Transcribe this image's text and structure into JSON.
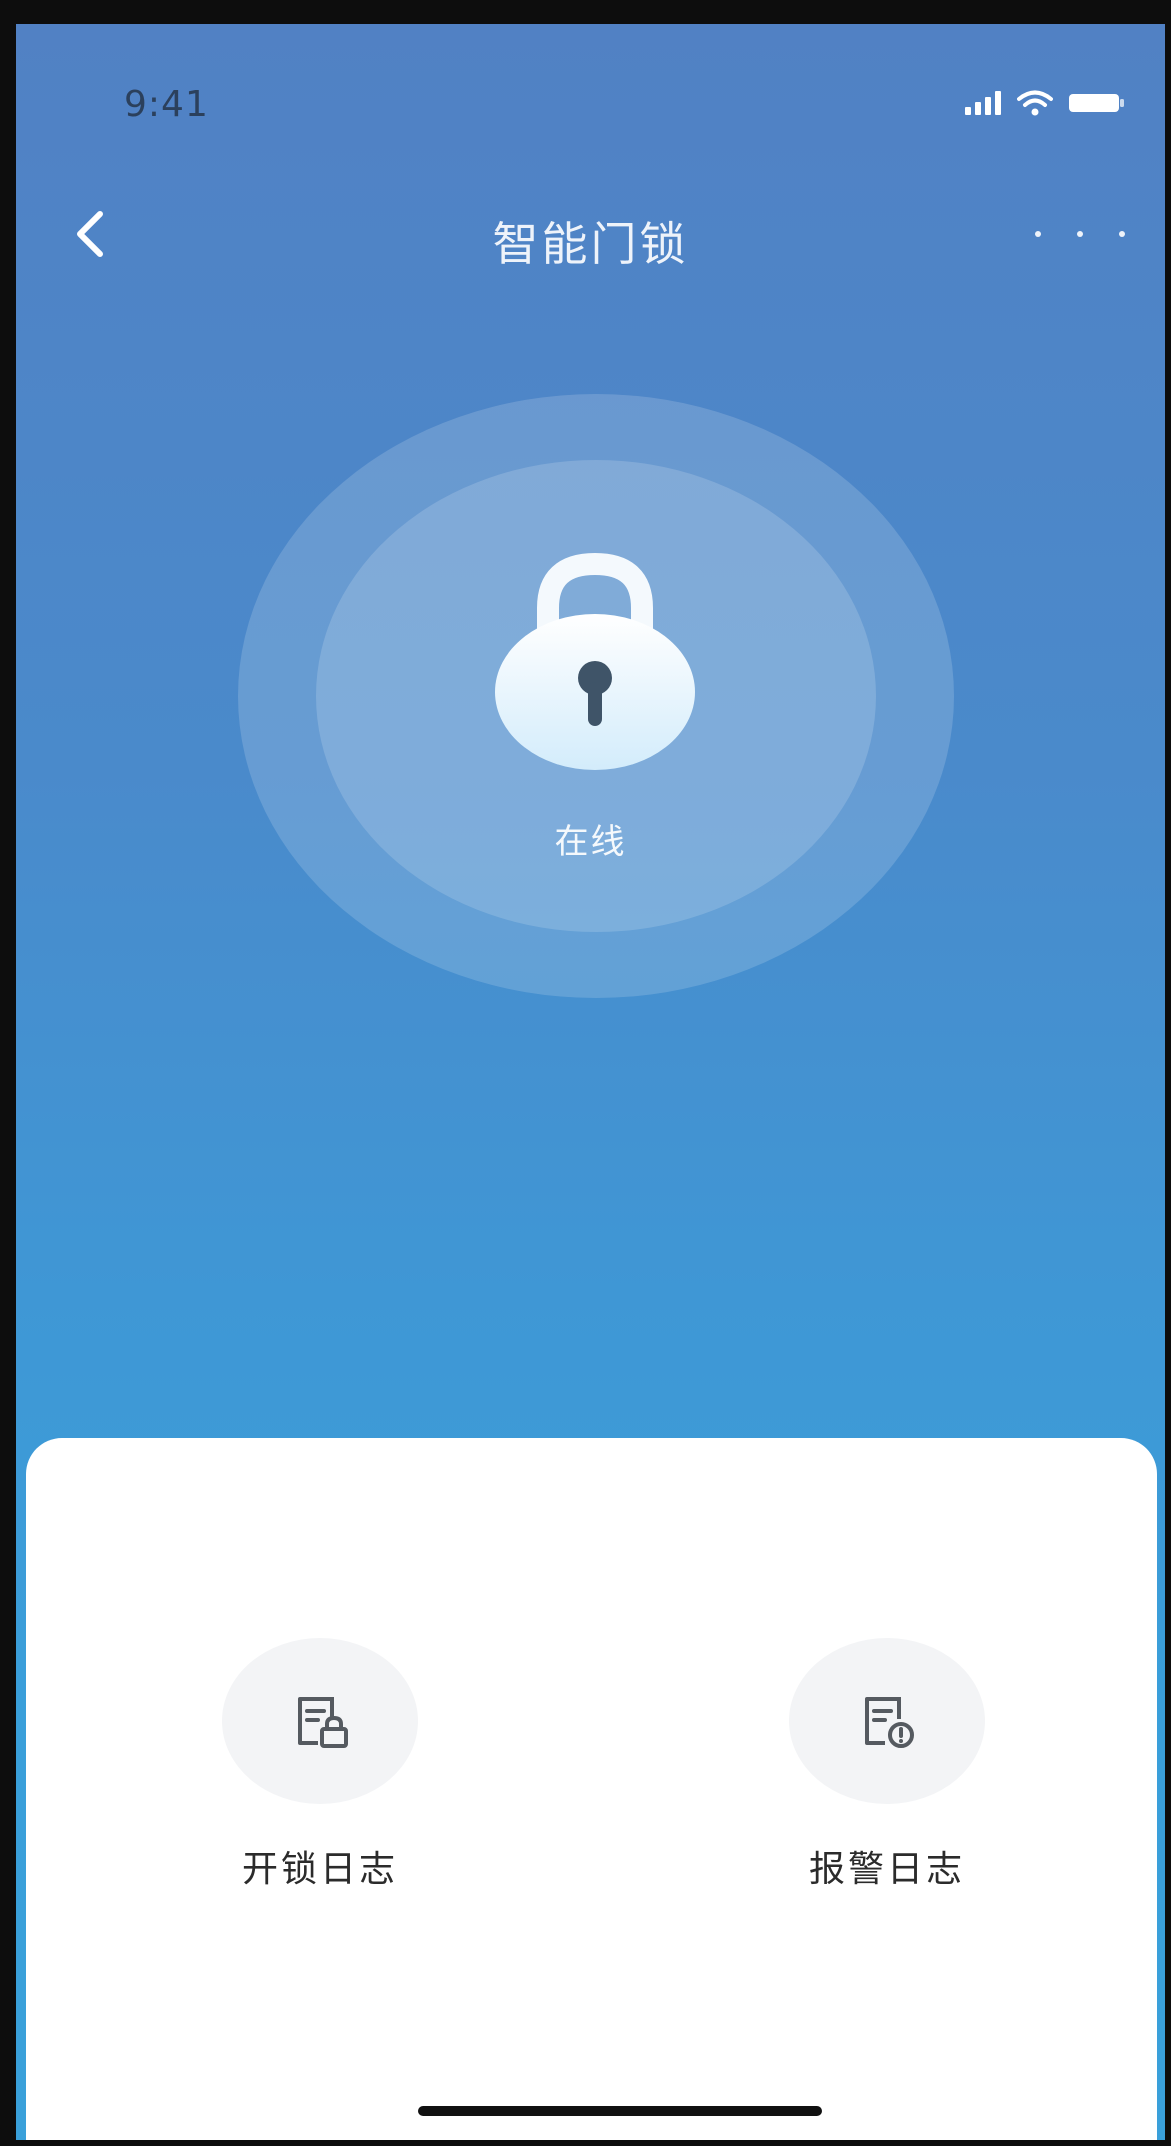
{
  "status_bar": {
    "time": "9:41"
  },
  "nav": {
    "title": "智能门锁"
  },
  "device": {
    "status": "在线"
  },
  "actions": [
    {
      "label": "开锁日志",
      "icon": "unlock-log-icon"
    },
    {
      "label": "报警日志",
      "icon": "alarm-log-icon"
    }
  ],
  "colors": {
    "header_gradient_top": "#5181c4",
    "header_gradient_bottom": "#3aa0da",
    "sheet_background": "#ffffff",
    "action_circle": "#f3f4f6"
  }
}
